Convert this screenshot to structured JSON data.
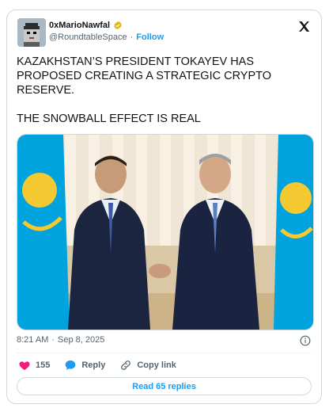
{
  "author": {
    "display_name": "0xMarioNawfal",
    "handle": "@RoundtableSpace",
    "separator": "·",
    "follow_label": "Follow",
    "verified_color": "#e2b719"
  },
  "tweet": {
    "text": "KAZAKHSTAN’S PRESIDENT TOKAYEV HAS PROPOSED CREATING A STRATEGIC CRYPTO RESERVE.\n\nTHE SNOWBALL EFFECT IS REAL"
  },
  "meta": {
    "time": "8:21 AM",
    "separator": "·",
    "date": "Sep 8, 2025"
  },
  "actions": {
    "like_count": "155",
    "reply_label": "Reply",
    "copy_label": "Copy link"
  },
  "read_replies_label": "Read 65 replies",
  "icons": {
    "logo": "x-logo-icon",
    "verified": "verified-badge-icon",
    "info": "info-icon",
    "like": "heart-icon",
    "reply": "speech-bubble-icon",
    "copy": "link-icon"
  },
  "colors": {
    "accent": "#1d9bf0",
    "like": "#f91880",
    "flag": "#00a3dd"
  }
}
